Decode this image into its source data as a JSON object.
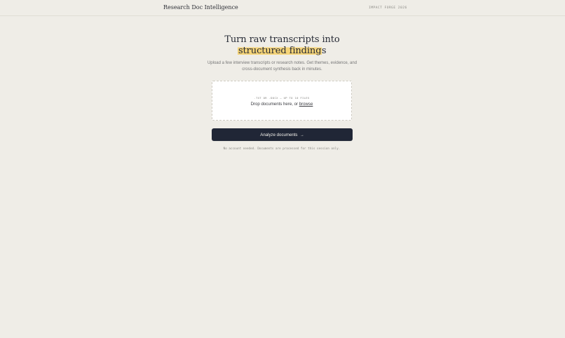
{
  "header": {
    "brand": "Research Doc Intelligence",
    "event": "IMPACT FORGE 2026"
  },
  "hero": {
    "headline_line1": "Turn raw transcripts into",
    "headline_highlight": "structured finding",
    "headline_suffix": "s",
    "subtitle": "Upload a few interview transcripts or research notes. Get themes, evidence, and cross-document synthesis back in minutes."
  },
  "upload": {
    "hint": ".TXT OR .DOCX — UP TO 10 FILES",
    "prompt": "Drop documents here, or",
    "browse_label": "browse"
  },
  "action": {
    "analyze_label": "Analyze documents",
    "arrow": "→"
  },
  "footer": {
    "note": "No account needed. Documents are processed for this session only."
  },
  "colors": {
    "background": "#efede7",
    "primary_button": "#202636",
    "highlight": "#f5d478"
  },
  "icons": {
    "arrow": "right-arrow-icon"
  }
}
